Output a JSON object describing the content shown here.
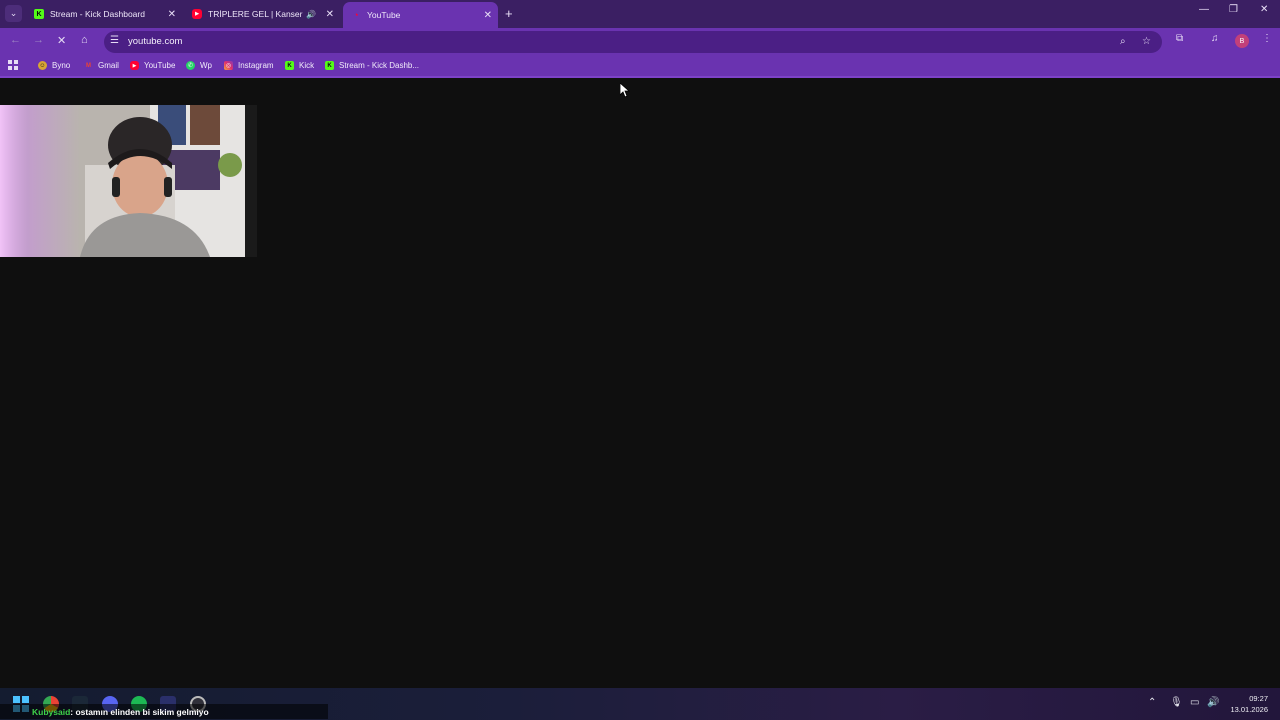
{
  "browser": {
    "tabs": [
      {
        "title": "Stream - Kick Dashboard",
        "favicon": "kick-icon",
        "active": false
      },
      {
        "title": "TRİPLERE GEL | Kanser oldu",
        "favicon": "youtube-icon",
        "active": false,
        "audio": true
      },
      {
        "title": "YouTube",
        "favicon": "youtube-icon",
        "active": true
      }
    ],
    "address_bar": {
      "url": "youtube.com",
      "loading": true
    },
    "profile_initial": "B",
    "bookmarks": [
      {
        "label": "Byno",
        "icon": "byno-icon"
      },
      {
        "label": "Gmail",
        "icon": "gmail-icon"
      },
      {
        "label": "YouTube",
        "icon": "youtube-icon"
      },
      {
        "label": "Wp",
        "icon": "whatsapp-icon"
      },
      {
        "label": "Instagram",
        "icon": "instagram-icon"
      },
      {
        "label": "Kick",
        "icon": "kick-icon"
      },
      {
        "label": "Stream - Kick Dashb...",
        "icon": "kick-icon"
      }
    ]
  },
  "overlay": {
    "chat_user": "Kubysaid",
    "chat_message": ": ostamın elinden bi sikim gelmiyo"
  },
  "taskbar": {
    "time": "09:27",
    "date": "13.01.2026"
  },
  "colors": {
    "tab_strip": "#3b1f63",
    "toolbar": "#6a33b0",
    "page_bg": "#0f0f0f",
    "kick_green": "#53fc18",
    "youtube_red": "#ff0033"
  }
}
